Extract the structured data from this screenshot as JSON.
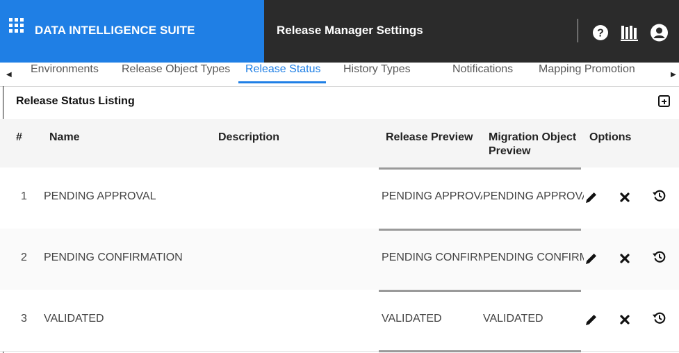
{
  "header": {
    "brand": "DATA INTELLIGENCE SUITE",
    "title": "Release Manager Settings",
    "icons": [
      "apps-grid-icon",
      "help-icon",
      "library-icon",
      "user-icon"
    ]
  },
  "tabs": [
    {
      "label": "Environments",
      "active": false
    },
    {
      "label": "Release Object Types",
      "active": false
    },
    {
      "label": "Release Status",
      "active": true
    },
    {
      "label": "History Types",
      "active": false
    },
    {
      "label": "Notifications",
      "active": false
    },
    {
      "label": "Mapping Promotion",
      "active": false
    }
  ],
  "section": {
    "title": "Release Status Listing"
  },
  "table": {
    "headers": {
      "num": "#",
      "name": "Name",
      "description": "Description",
      "release_preview": "Release Preview",
      "migration_preview_line1": "Migration Object",
      "migration_preview_line2": "Preview",
      "options": "Options"
    },
    "rows": [
      {
        "num": "1",
        "name": "PENDING APPROVAL",
        "description": "",
        "release_preview": "PENDING APPROVAL",
        "migration_preview": "PENDING APPROVAL"
      },
      {
        "num": "2",
        "name": "PENDING CONFIRMATION",
        "description": "",
        "release_preview": "PENDING CONFIRMATION",
        "migration_preview": "PENDING CONFIRMATION"
      },
      {
        "num": "3",
        "name": "VALIDATED",
        "description": "",
        "release_preview": "VALIDATED",
        "migration_preview": "VALIDATED"
      }
    ]
  },
  "colors": {
    "brand_blue": "#1f7fe5",
    "header_dark": "#2b2b2b"
  }
}
